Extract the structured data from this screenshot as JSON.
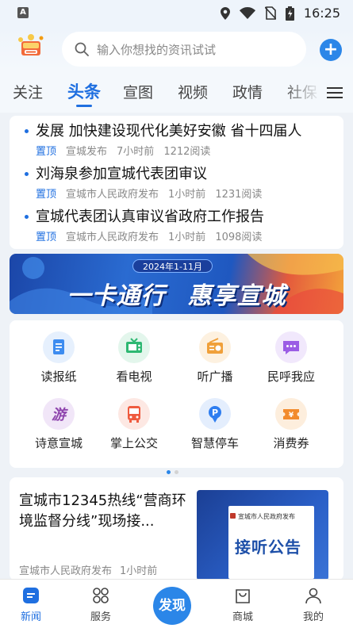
{
  "status_bar": {
    "time": "16:25"
  },
  "search": {
    "placeholder": "输入你想找的资讯试试"
  },
  "tabs": [
    {
      "label": "关注"
    },
    {
      "label": "头条"
    },
    {
      "label": "宣图"
    },
    {
      "label": "视频"
    },
    {
      "label": "政情"
    },
    {
      "label": "社保"
    }
  ],
  "news": [
    {
      "title": "发展 加快建设现代化美好安徽 省十四届人",
      "pin": "置顶",
      "source": "宣城发布",
      "time": "7小时前",
      "reads": "1212阅读"
    },
    {
      "title": "刘海泉参加宣城代表团审议",
      "pin": "置顶",
      "source": "宣城市人民政府发布",
      "time": "1小时前",
      "reads": "1231阅读"
    },
    {
      "title": "宣城代表团认真审议省政府工作报告",
      "pin": "置顶",
      "source": "宣城市人民政府发布",
      "time": "1小时前",
      "reads": "1098阅读"
    }
  ],
  "banner": {
    "date": "2024年1-11月",
    "slogan_a": "一卡通行",
    "slogan_b": "惠享宣城"
  },
  "services": [
    {
      "label": "读报纸",
      "icon": "newspaper-icon",
      "color": "#3d8cf0"
    },
    {
      "label": "看电视",
      "icon": "tv-icon",
      "color": "#2eb872"
    },
    {
      "label": "听广播",
      "icon": "radio-icon",
      "color": "#f0a03a"
    },
    {
      "label": "民呼我应",
      "icon": "message-icon",
      "color": "#9b5de5"
    },
    {
      "label": "诗意宣城",
      "icon": "travel-icon",
      "color": "#8e44ad"
    },
    {
      "label": "掌上公交",
      "icon": "bus-icon",
      "color": "#ef5b3f"
    },
    {
      "label": "智慧停车",
      "icon": "parking-icon",
      "color": "#2f7ef0"
    },
    {
      "label": "消费券",
      "icon": "coupon-icon",
      "color": "#f28b2d"
    }
  ],
  "feature": {
    "title": "宣城市12345热线“营商环境监督分线”现场接...",
    "source": "宣城市人民政府发布",
    "time": "1小时前",
    "thumb_org": "宣城市人民政府发布",
    "thumb_title": "接听公告"
  },
  "bottom_nav": [
    {
      "label": "新闻"
    },
    {
      "label": "服务"
    },
    {
      "label": "发现"
    },
    {
      "label": "商城"
    },
    {
      "label": "我的"
    }
  ],
  "colors": {
    "accent": "#1f6fe0",
    "button": "#2b86e8"
  }
}
